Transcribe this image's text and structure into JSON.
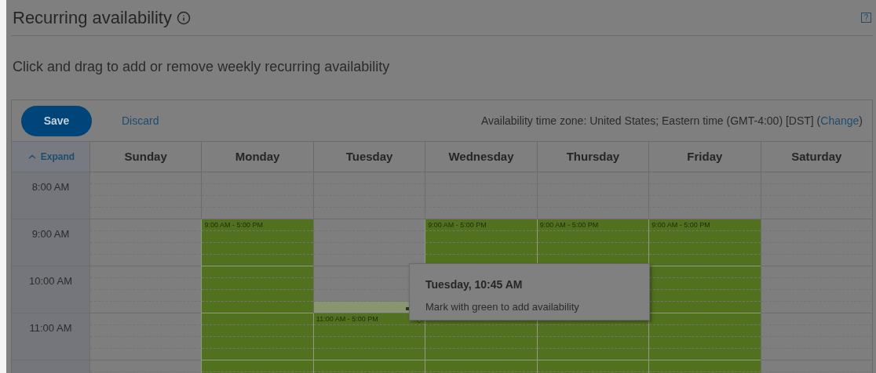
{
  "title": "Recurring availability",
  "help": "?",
  "instructions": "Click and drag to add or remove weekly recurring availability",
  "toolbar": {
    "save": "Save",
    "discard": "Discard",
    "timezone": "Availability time zone: United States; Eastern time (GMT-4:00) [DST] (",
    "change": "Change",
    "timezone_end": ")"
  },
  "expand": {
    "label": "Expand",
    "expanded": false
  },
  "days": [
    "Sunday",
    "Monday",
    "Tuesday",
    "Wednesday",
    "Thursday",
    "Friday",
    "Saturday"
  ],
  "rows": [
    {
      "time": "8:00 AM",
      "cells": [
        {
          "available": false
        },
        {
          "available": false
        },
        {
          "available": false
        },
        {
          "available": false
        },
        {
          "available": false
        },
        {
          "available": false
        },
        {
          "available": false
        }
      ]
    },
    {
      "time": "9:00 AM",
      "cells": [
        {
          "available": false
        },
        {
          "available": true,
          "label": "9:00 AM - 5:00 PM"
        },
        {
          "available": false
        },
        {
          "available": true,
          "label": "9:00 AM - 5:00 PM"
        },
        {
          "available": true,
          "label": "9:00 AM - 5:00 PM"
        },
        {
          "available": true,
          "label": "9:00 AM - 5:00 PM"
        },
        {
          "available": false
        }
      ]
    },
    {
      "time": "10:00 AM",
      "cells": [
        {
          "available": false
        },
        {
          "available": true
        },
        {
          "available": false,
          "pending": true
        },
        {},
        {},
        {
          "available": true
        },
        {
          "available": false
        }
      ]
    },
    {
      "time": "11:00 AM",
      "cells": [
        {
          "available": false
        },
        {
          "available": true
        },
        {
          "available": true,
          "label": "11:00 AM - 5:00 PM"
        },
        {
          "available": true
        },
        {
          "available": true
        },
        {
          "available": true
        },
        {
          "available": false
        }
      ]
    },
    {
      "cells": [
        {
          "available": false
        },
        {
          "available": true
        },
        {
          "available": true
        },
        {
          "available": true
        },
        {
          "available": true
        },
        {
          "available": true
        },
        {
          "available": false
        }
      ]
    }
  ],
  "tooltip": {
    "title": "Tuesday, 10:45 AM",
    "text": "Mark with green to add availability"
  }
}
